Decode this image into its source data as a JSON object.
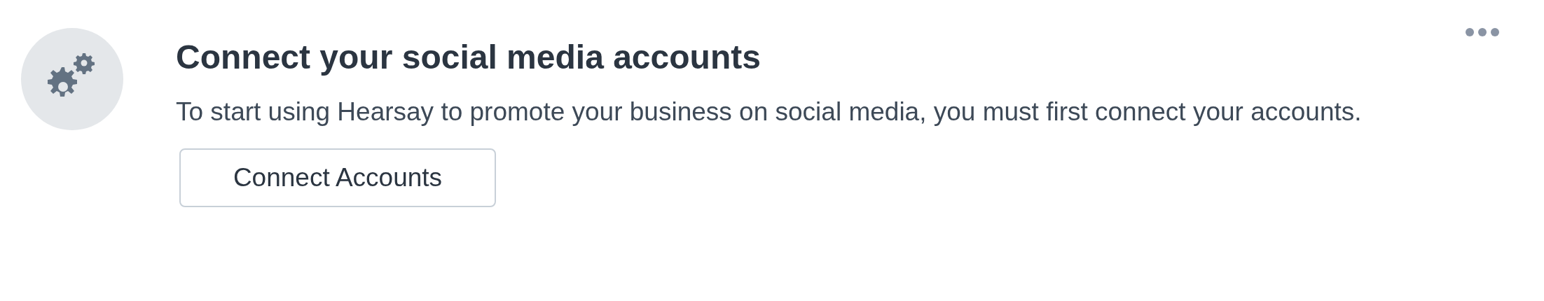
{
  "title": "Connect your social media accounts",
  "description": "To start using Hearsay to promote your business on social media, you must first connect your accounts.",
  "button": "Connect Accounts"
}
